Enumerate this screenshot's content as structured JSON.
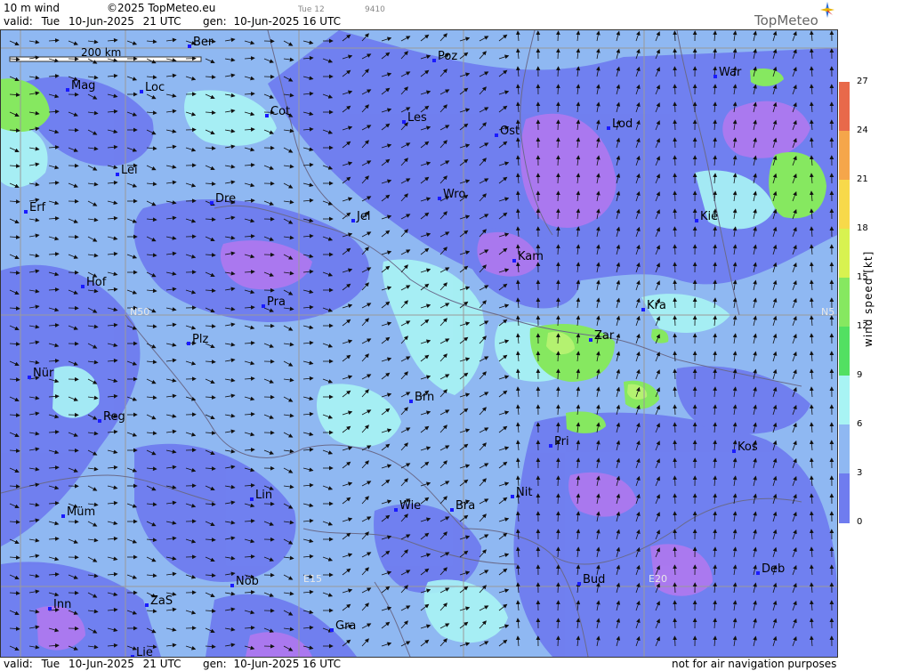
{
  "header": {
    "title": "10 m wind",
    "copyright": "©2025 TopMeteo.eu",
    "valid_label": "valid:",
    "valid_day": "Tue",
    "valid_date": "10-Jun-2025",
    "valid_time": "21 UTC",
    "gen_label": "gen:",
    "gen_date": "10-Jun-2025 16 UTC",
    "small_a": "Tue 12",
    "small_b": "9410",
    "logo_text": "TopMeteo"
  },
  "scale_bar": {
    "label": "200 km"
  },
  "grid_labels": [
    "N50",
    "N5",
    "E15",
    "E20"
  ],
  "cities": [
    {
      "name": "Ber"
    },
    {
      "name": "Poz"
    },
    {
      "name": "Mag"
    },
    {
      "name": "Loc"
    },
    {
      "name": "War"
    },
    {
      "name": "Cot"
    },
    {
      "name": "Les"
    },
    {
      "name": "Lod"
    },
    {
      "name": "Ost"
    },
    {
      "name": "Lei"
    },
    {
      "name": "Wro"
    },
    {
      "name": "Erf"
    },
    {
      "name": "Dre"
    },
    {
      "name": "Jel"
    },
    {
      "name": "Kie"
    },
    {
      "name": "Kam"
    },
    {
      "name": "Hof"
    },
    {
      "name": "Pra"
    },
    {
      "name": "Kra"
    },
    {
      "name": "Zar"
    },
    {
      "name": "Plz"
    },
    {
      "name": "Nür"
    },
    {
      "name": "Brn"
    },
    {
      "name": "Reg"
    },
    {
      "name": "Pri"
    },
    {
      "name": "Kos"
    },
    {
      "name": "Lin"
    },
    {
      "name": "Nit"
    },
    {
      "name": "Müm"
    },
    {
      "name": "Wie"
    },
    {
      "name": "Bra"
    },
    {
      "name": "Deb"
    },
    {
      "name": "Nöb"
    },
    {
      "name": "Bud"
    },
    {
      "name": "Inn"
    },
    {
      "name": "ZaS"
    },
    {
      "name": "Gra"
    },
    {
      "name": "Lie"
    }
  ],
  "legend": {
    "title": "wind speed [kt]",
    "ticks": [
      "27",
      "24",
      "21",
      "18",
      "15",
      "12",
      "9",
      "6",
      "3",
      "0"
    ],
    "colors": [
      "#e8694a",
      "#f5a64a",
      "#f7d94a",
      "#d8f250",
      "#86e860",
      "#52e062",
      "#a8f4f4",
      "#8fb8f2",
      "#6f7cef",
      "#b078ee"
    ]
  },
  "footer": {
    "valid_label": "valid:",
    "valid_day": "Tue",
    "valid_date": "10-Jun-2025",
    "valid_time": "21 UTC",
    "gen_label": "gen:",
    "gen_date": "10-Jun-2025 16 UTC",
    "disclaimer": "not for air navigation purposes"
  }
}
